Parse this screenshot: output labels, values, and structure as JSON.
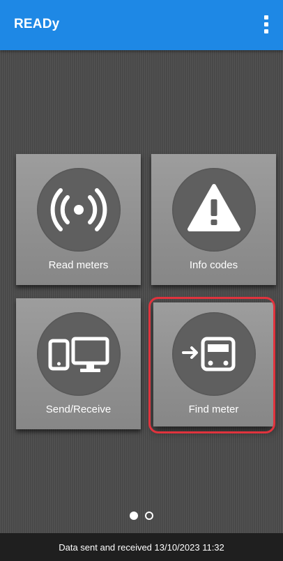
{
  "app_bar": {
    "title": "READy",
    "menu_icon": "more-vertical-icon",
    "color": "#1e88e5"
  },
  "tiles": [
    {
      "label": "Read meters",
      "icon": "radio-signal-icon"
    },
    {
      "label": "Info codes",
      "icon": "warning-icon"
    },
    {
      "label": "Send/Receive",
      "icon": "phone-monitor-icon"
    },
    {
      "label": "Find meter",
      "icon": "find-meter-icon",
      "highlighted": true
    }
  ],
  "pager": {
    "pages": 2,
    "current": 1
  },
  "status": {
    "text": "Data sent and received 13/10/2023 11:32"
  },
  "colors": {
    "highlight": "#e0333d",
    "tile": "#959595",
    "icon_circle": "#5f5f5f"
  }
}
